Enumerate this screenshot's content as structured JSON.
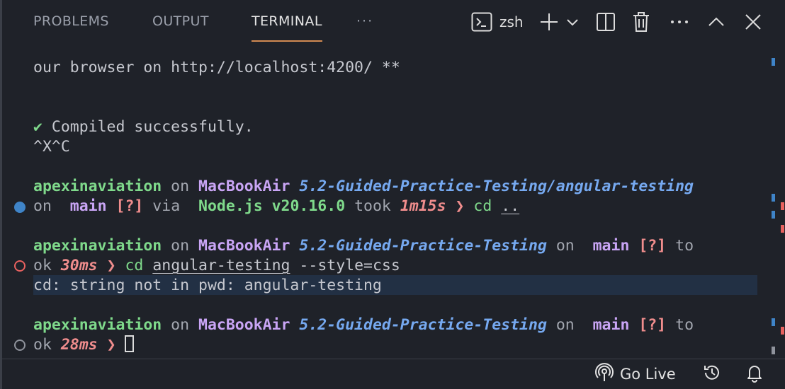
{
  "tabs": {
    "problems": "PROBLEMS",
    "output": "OUTPUT",
    "terminal": "TERMINAL",
    "more": "···"
  },
  "toolbar": {
    "shell": "zsh"
  },
  "terminal": {
    "line1": "our browser on http://localhost:4200/ **",
    "compiled_check": "✔",
    "compiled": " Compiled successfully.",
    "ctrl": "^X^C",
    "p1": {
      "user": "apexinaviation",
      "on": " on ",
      "host": "MacBookAir",
      "dir": " 5.2-Guided-Practice-Testing/angular-testing",
      "on2": "on ",
      "git_glyph": "",
      "branch": " main",
      "status": " [?]",
      "via": " via ",
      "node_glyph": "",
      "node": " Node.js v20.16.0",
      "took": " took ",
      "dur": "1m15s",
      "arrow": " ❯ ",
      "cmd": "cd",
      "arg": ".."
    },
    "p2": {
      "user": "apexinaviation",
      "on": " on ",
      "host": "MacBookAir",
      "dir": " 5.2-Guided-Practice-Testing",
      "on2": " on ",
      "git_glyph": "",
      "branch": " main",
      "status": " [?]",
      "to": " to",
      "ok": "ok ",
      "dur": "30ms",
      "arrow": " ❯ ",
      "cmd": "cd",
      "arg": "angular-testing",
      "flag": " --style=css"
    },
    "error": "cd: string not in pwd: angular-testing",
    "p3": {
      "user": "apexinaviation",
      "on": " on ",
      "host": "MacBookAir",
      "dir": " 5.2-Guided-Practice-Testing",
      "on2": " on ",
      "git_glyph": "",
      "branch": " main",
      "status": " [?]",
      "to": " to",
      "ok": "ok ",
      "dur": "28ms",
      "arrow": " ❯ "
    }
  },
  "statusbar": {
    "go_live": "Go Live"
  },
  "colors": {
    "background": "#1f2229",
    "active_tab_underline": "#d18a52",
    "user": "#7fd98b",
    "host": "#c9a5f5",
    "dir": "#76a9f0",
    "duration": "#f08d8d"
  }
}
